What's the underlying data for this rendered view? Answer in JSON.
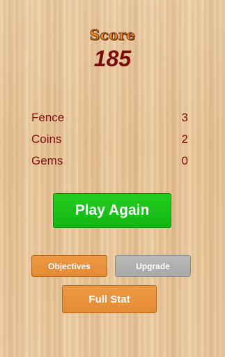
{
  "header": {
    "score_label": "Score",
    "score_value": "185"
  },
  "stats": [
    {
      "label": "Fence",
      "value": "3"
    },
    {
      "label": "Coins",
      "value": "2"
    },
    {
      "label": "Gems",
      "value": "0"
    }
  ],
  "buttons": {
    "play_again": "Play Again",
    "objectives": "Objectives",
    "upgrade": "Upgrade",
    "full_stat": "Full Stat"
  },
  "colors": {
    "play_again": "#1cc31c",
    "orange_buttons": "#e8923d",
    "upgrade_disabled": "#b0b0b0",
    "stat_text": "#7a1212",
    "score_value": "#7a0a0a",
    "score_label": "#e8892a"
  }
}
